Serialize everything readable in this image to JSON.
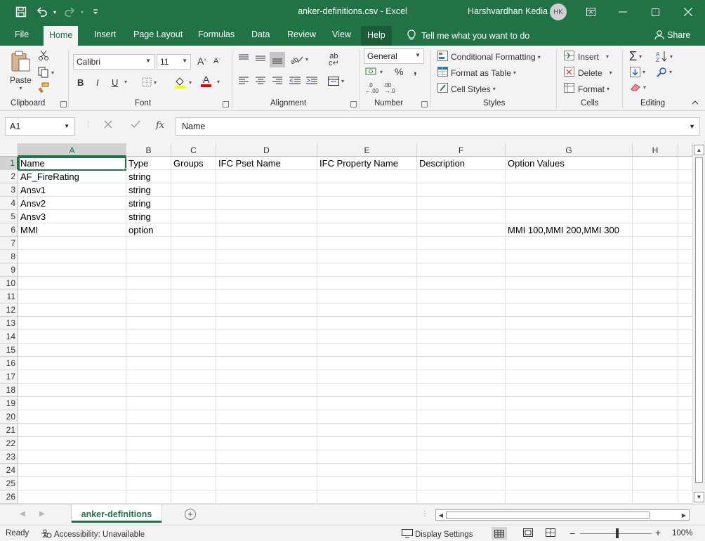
{
  "window": {
    "title": "anker-definitions.csv  -  Excel",
    "user_name": "Harshvardhan Kedia",
    "user_initials": "HK"
  },
  "quick_access": {
    "save_icon": "save-icon",
    "undo_icon": "undo-icon",
    "redo_icon": "redo-icon",
    "customize_icon": "customize-qat-icon"
  },
  "ribbon_tabs": [
    "File",
    "Home",
    "Insert",
    "Page Layout",
    "Formulas",
    "Data",
    "Review",
    "View",
    "Help"
  ],
  "active_tab": "Home",
  "tell_me": "Tell me what you want to do",
  "share_label": "Share",
  "ribbon": {
    "clipboard": {
      "label": "Clipboard",
      "paste": "Paste"
    },
    "font": {
      "label": "Font",
      "font_name": "Calibri",
      "font_size": "11",
      "bold": "B",
      "italic": "I",
      "underline": "U"
    },
    "alignment": {
      "label": "Alignment"
    },
    "number": {
      "label": "Number",
      "format": "General",
      "percent": "%",
      "comma": ","
    },
    "styles": {
      "label": "Styles",
      "conditional": "Conditional Formatting",
      "format_table": "Format as Table",
      "cell_styles": "Cell Styles"
    },
    "cells": {
      "label": "Cells",
      "insert": "Insert",
      "delete": "Delete",
      "format": "Format"
    },
    "editing": {
      "label": "Editing"
    }
  },
  "formula_bar": {
    "name_box": "A1",
    "fx": "fx",
    "content": "Name"
  },
  "grid": {
    "columns": [
      "A",
      "B",
      "C",
      "D",
      "E",
      "F",
      "G",
      "H"
    ],
    "selected_column": "A",
    "row_numbers": [
      "1",
      "2",
      "3",
      "4",
      "5",
      "6",
      "7",
      "8",
      "9",
      "10",
      "11",
      "12",
      "13",
      "14",
      "15",
      "16",
      "17",
      "18",
      "19",
      "20",
      "21",
      "22",
      "23",
      "24",
      "25",
      "26"
    ],
    "selected_row": "1",
    "rows": [
      [
        "Name",
        "Type",
        "Groups",
        "IFC Pset Name",
        "IFC Property Name",
        "Description",
        "Option Values",
        ""
      ],
      [
        "AF_FireRating",
        "string",
        "",
        "",
        "",
        "",
        "",
        ""
      ],
      [
        "Ansv1",
        "string",
        "",
        "",
        "",
        "",
        "",
        ""
      ],
      [
        "Ansv2",
        "string",
        "",
        "",
        "",
        "",
        "",
        ""
      ],
      [
        "Ansv3",
        "string",
        "",
        "",
        "",
        "",
        "",
        ""
      ],
      [
        "MMI",
        "option",
        "",
        "",
        "",
        "",
        "MMI 100,MMI 200,MMI 300",
        ""
      ]
    ],
    "active_cell": "A1"
  },
  "sheets": {
    "tabs": [
      "anker-definitions"
    ],
    "active": "anker-definitions"
  },
  "status_bar": {
    "mode": "Ready",
    "accessibility": "Accessibility: Unavailable",
    "display_settings": "Display Settings",
    "zoom": "100%"
  },
  "colors": {
    "excel_green": "#217346",
    "ribbon_bg": "#f3f3f3"
  }
}
